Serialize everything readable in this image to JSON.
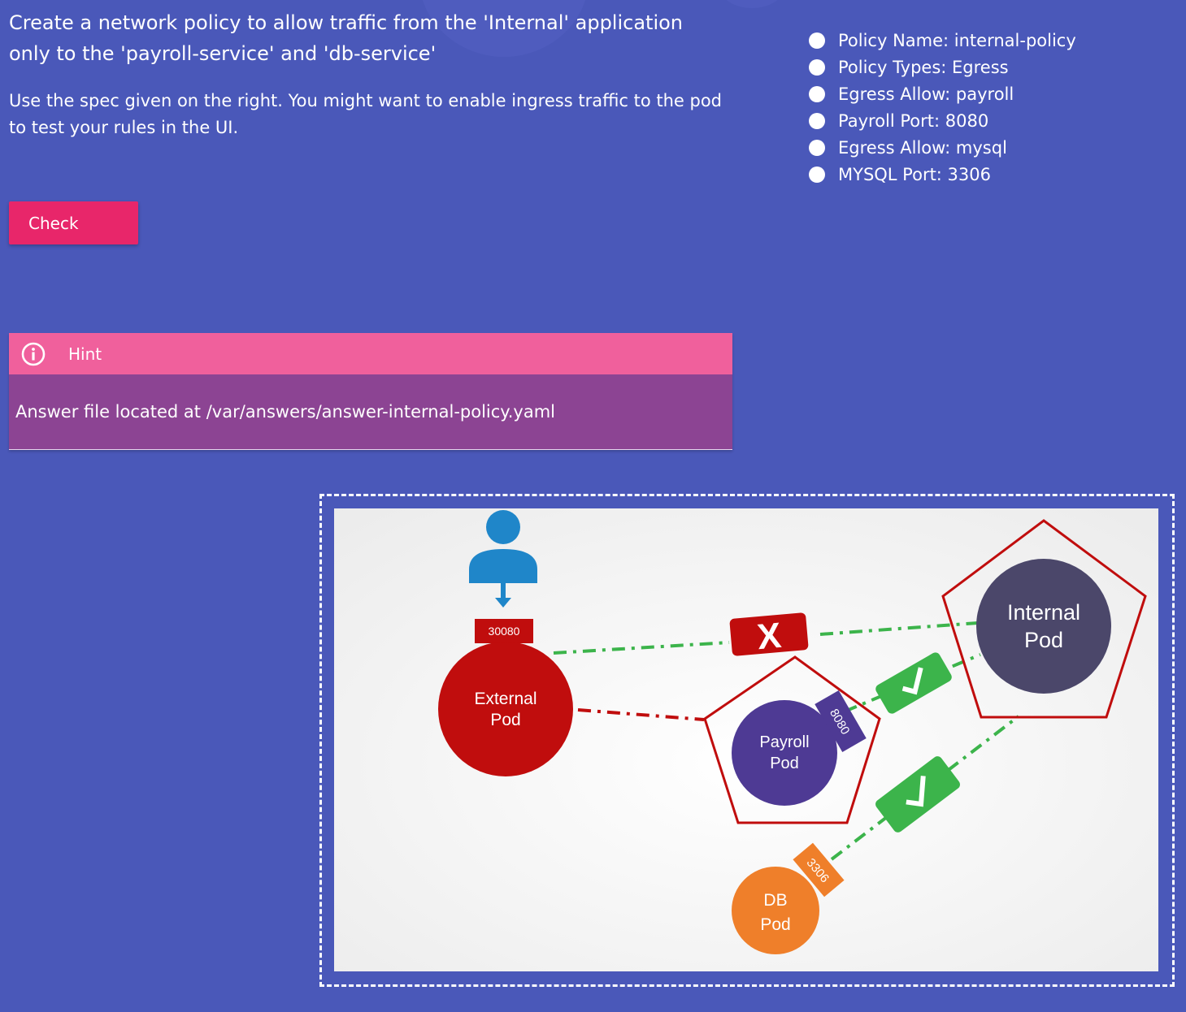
{
  "question": "Create a network policy to allow traffic from the 'Internal' application only to the 'payroll-service' and 'db-service'",
  "instruction": "Use the spec given on the right. You might want to enable ingress traffic to the pod to test your rules in the UI.",
  "check_button": "Check",
  "hint": {
    "title": "Hint",
    "icon": "info-icon",
    "body": "Answer file located at /var/answers/answer-internal-policy.yaml"
  },
  "spec": [
    {
      "label": "Policy Name: internal-policy"
    },
    {
      "label": "Policy Types: Egress"
    },
    {
      "label": "Egress Allow: payroll"
    },
    {
      "label": "Payroll Port: 8080"
    },
    {
      "label": "Egress Allow: mysql"
    },
    {
      "label": "MYSQL Port: 3306"
    }
  ],
  "diagram": {
    "user_icon": "user-icon",
    "node_port": "30080",
    "external_pod": [
      "External",
      "Pod"
    ],
    "payroll_pod": [
      "Payroll",
      "Pod"
    ],
    "internal_pod": [
      "Internal",
      "Pod"
    ],
    "db_pod": [
      "DB",
      "Pod"
    ],
    "payroll_port": "8080",
    "db_port": "3306",
    "blocked_mark": "X",
    "colors": {
      "background": "#4a58b9",
      "check_button": "#e8266a",
      "hint_header": "#f0609c",
      "hint_body": "#8c4493",
      "external_pod": "#c00d0d",
      "payroll_pod": "#4e3a94",
      "internal_pod": "#4b476a",
      "db_pod": "#ef7f2a",
      "policy_outline": "#c00d0d",
      "allowed": "#3cb44b",
      "user": "#1f86c9"
    }
  }
}
